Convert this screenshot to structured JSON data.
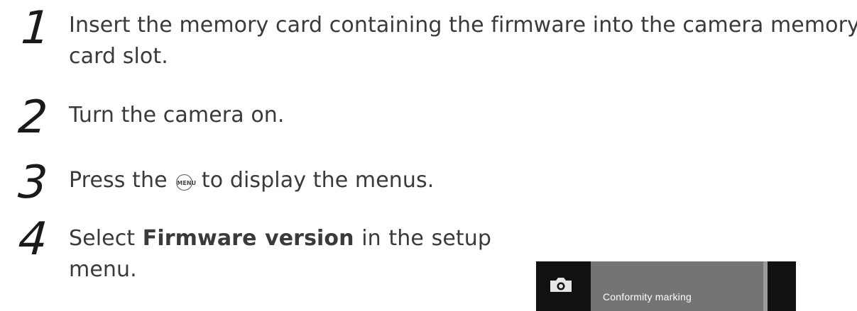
{
  "steps": [
    {
      "number": "1",
      "line1": "Insert the memory card containing the firmware into the camera memory",
      "line2": "card slot."
    },
    {
      "number": "2",
      "text": "Turn the camera on."
    },
    {
      "number": "3",
      "before": "Press the",
      "button": "MENU",
      "after": "to display the menus."
    },
    {
      "number": "4",
      "before": "Select",
      "bold": "Firmware version",
      "after": "in the setup",
      "line2": "menu."
    }
  ],
  "screen": {
    "icon": "camera-icon",
    "item": "Conformity marking"
  }
}
